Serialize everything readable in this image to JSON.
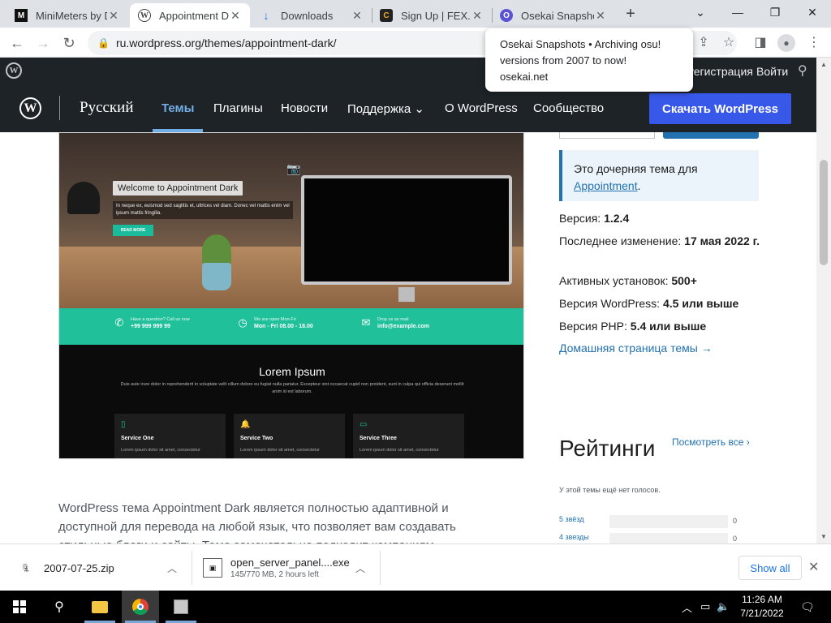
{
  "browser": {
    "tabs": [
      {
        "label": "MiniMeters by D",
        "favicon": "M"
      },
      {
        "label": "Appointment Da",
        "favicon": "W"
      },
      {
        "label": "Downloads",
        "favicon": "↓"
      },
      {
        "label": "Sign Up | FEX.N",
        "favicon": "C"
      },
      {
        "label": "Osekai Snapsho",
        "favicon": "O"
      }
    ],
    "new_tab": "+",
    "url": "ru.wordpress.org/themes/appointment-dark/",
    "popup": {
      "title": "Osekai Snapshots • Archiving osu! versions from 2007 to now!",
      "domain": "osekai.net"
    }
  },
  "wp_admin_bar": {
    "register": "Регистрация",
    "login": "Войти"
  },
  "wp_header": {
    "locale": "Русский",
    "nav": [
      {
        "label": "Темы",
        "active": true
      },
      {
        "label": "Плагины",
        "active": false
      },
      {
        "label": "Новости",
        "active": false
      },
      {
        "label": "Поддержка ⌄",
        "active": false
      },
      {
        "label": "О WordPress",
        "active": false
      },
      {
        "label": "Сообщество",
        "active": false
      }
    ],
    "download_button": "Скачать WordPress"
  },
  "theme_preview": {
    "hero_title": "Welcome to Appointment Dark",
    "hero_text": "In neque ex, euismod sed sagittis et, ultrices vel diam. Donec vel mattis enim vel ipsum mattis fringilla.",
    "hero_button": "READ MORE",
    "info": [
      {
        "icon": "phone-icon",
        "line1": "Have a question? Call us now",
        "line2": "+99 999 999 99"
      },
      {
        "icon": "clock-icon",
        "line1": "We are open Mon-Fri",
        "line2": "Mon - Fri 08.00 - 18.00"
      },
      {
        "icon": "mail-icon",
        "line1": "Drop us an mail",
        "line2": "info@example.com"
      }
    ],
    "section_title": "Lorem Ipsum",
    "section_text": "Duis aute irure dolor in reprehenderit in voluptate velit cillum dolore eu fugiat nulla pariatur. Excepteur sint occaecat cupid non proident, sunt in culpa qui officia deserunt mollit anim id est laborum.",
    "services": [
      {
        "name": "Service One",
        "text": "Lorem ipsum dolor sit amet, consectetur"
      },
      {
        "name": "Service Two",
        "text": "Lorem ipsum dolor sit amet, consectetur"
      },
      {
        "name": "Service Three",
        "text": "Lorem ipsum dolor sit amet, consectetur"
      }
    ]
  },
  "description": "WordPress тема Appointment Dark является полностью адаптивной и доступной для перевода на любой язык, что позволяет вам создавать стильные блоги и сайты. Тема замечательно подходит компаниям",
  "sidebar": {
    "parent_note_prefix": "Это дочерняя тема для",
    "parent_link": "Appointment",
    "parent_note_suffix": ".",
    "meta": [
      {
        "label": "Версия: ",
        "value": "1.2.4"
      },
      {
        "label": "Последнее изменение: ",
        "value": "17 мая 2022 г."
      },
      {
        "label": "Активных установок: ",
        "value": "500+"
      },
      {
        "label": "Версия WordPress: ",
        "value": "4.5 или выше"
      },
      {
        "label": "Версия PHP: ",
        "value": "5.4 или выше"
      }
    ],
    "home_link": "Домашняя страница темы →",
    "ratings_title": "Рейтинги",
    "see_all": "Посмотреть все ›",
    "no_votes": "У этой темы ещё нет голосов.",
    "stars": [
      {
        "label": "5 звёзд",
        "count": "0"
      },
      {
        "label": "4 звезды",
        "count": "0"
      }
    ]
  },
  "downloads": [
    {
      "name": "2007-07-25.zip",
      "sub": ""
    },
    {
      "name": "open_server_panel....exe",
      "sub": "145/770 MB, 2 hours left"
    }
  ],
  "show_all": "Show all",
  "taskbar": {
    "time": "11:26 AM",
    "date": "7/21/2022"
  }
}
